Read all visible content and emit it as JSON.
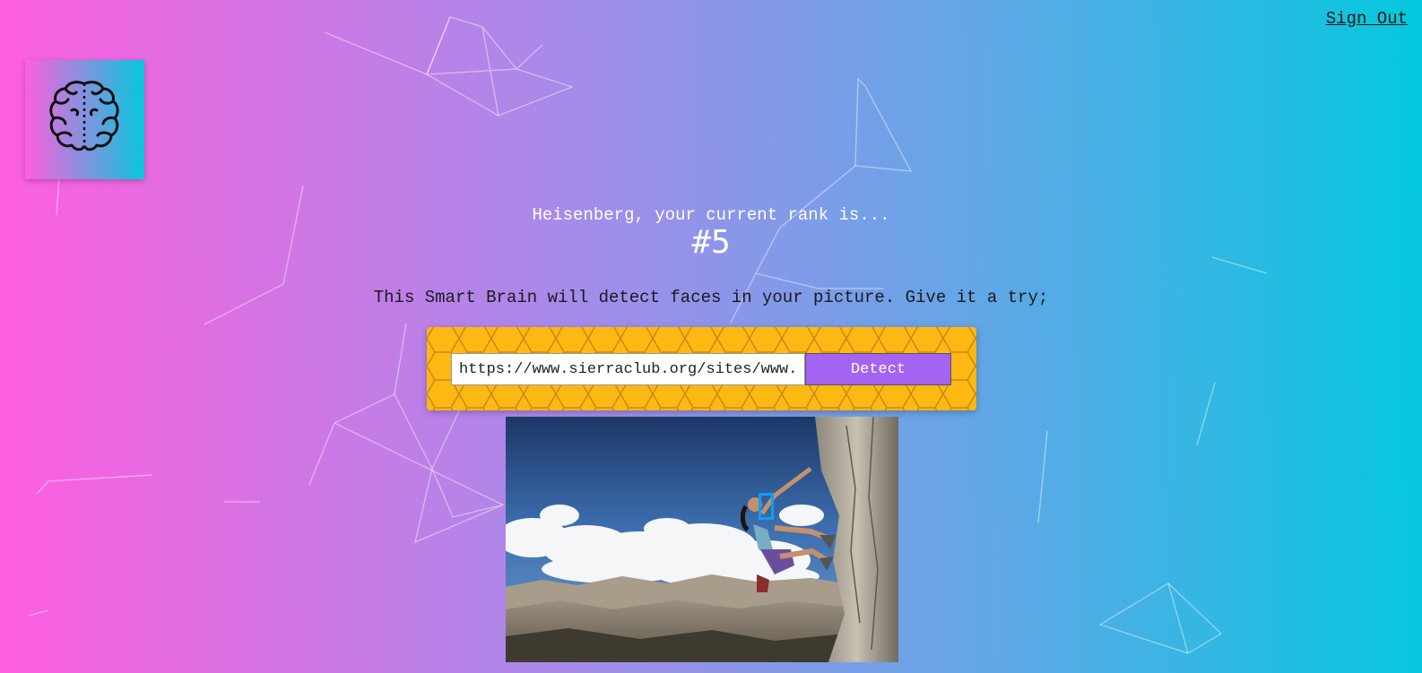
{
  "nav": {
    "signout_label": "Sign Out"
  },
  "logo": {
    "icon": "brain-icon"
  },
  "rank": {
    "message": "Heisenberg, your current rank is...",
    "value": "#5"
  },
  "intro": {
    "text": "This Smart Brain will detect faces in your picture. Give it a try;"
  },
  "form": {
    "url_value": "https://www.sierraclub.org/sites/www.sierraclub.org/files/styles/flexslider_full/public/sierra/articles/big/SIERRA%20Climber%20WB.jpg",
    "detect_label": "Detect"
  },
  "colors": {
    "gradient_left": "#ff5edf",
    "gradient_right": "#04c8de",
    "form_bg": "#fdb813",
    "detect_btn": "#a463f2",
    "face_box": "#149df2"
  }
}
